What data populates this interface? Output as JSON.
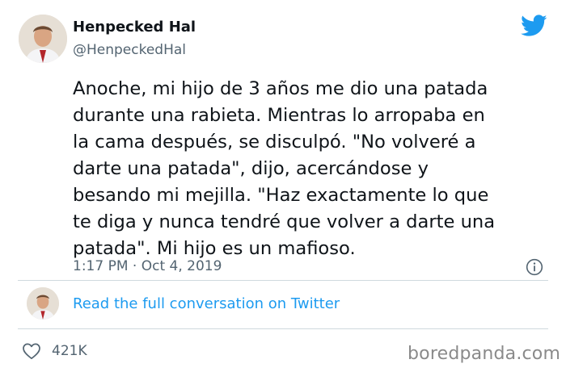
{
  "author": {
    "display_name": "Henpecked Hal",
    "handle": "@HenpeckedHal"
  },
  "tweet": {
    "text": "Anoche, mi hijo de 3 años me dio una patada\ndurante una rabieta. Mientras lo arropaba en\nla cama después, se disculpó. \"No volveré a\ndarte una patada\", dijo, acercándose y\nbesando mi mejilla. \"Haz exactamente lo que\nte diga y nunca tendré que volver a darte una\npatada\". Mi hijo es un mafioso.",
    "time": "1:17 PM",
    "separator": "·",
    "date": "Oct 4, 2019"
  },
  "conversation_link": "Read the full conversation on Twitter",
  "likes": "421K",
  "watermark": "boredpanda.com",
  "colors": {
    "twitter_blue": "#1d9bf0",
    "text_primary": "#0f1419",
    "text_secondary": "#536471",
    "divider": "#cfd9de"
  },
  "icons": {
    "brand": "twitter-bird-icon",
    "info": "info-icon",
    "like": "heart-icon"
  }
}
